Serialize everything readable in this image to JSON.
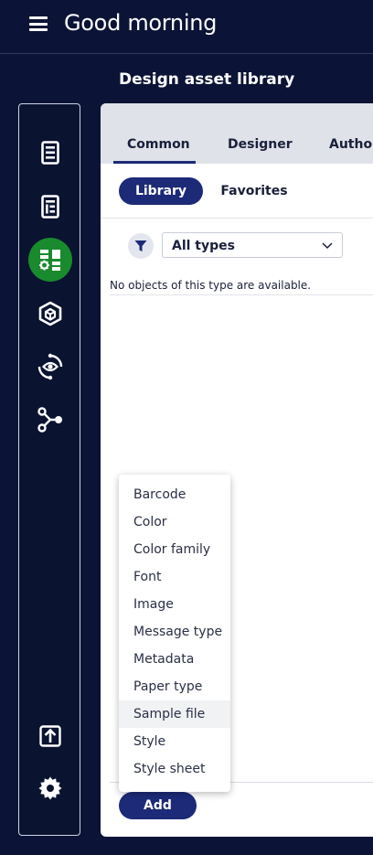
{
  "header": {
    "greeting": "Good morning"
  },
  "section": {
    "title": "Design asset library"
  },
  "sidebar": {
    "items": [
      {
        "icon": "document-list-icon",
        "active": false
      },
      {
        "icon": "template-icon",
        "active": false
      },
      {
        "icon": "design-assets-icon",
        "active": true
      },
      {
        "icon": "package-cube-icon",
        "active": false
      },
      {
        "icon": "preview-eye-icon",
        "active": false
      },
      {
        "icon": "workflow-icon",
        "active": false
      }
    ],
    "bottom_items": [
      {
        "icon": "upload-icon"
      },
      {
        "icon": "settings-gear-icon"
      }
    ],
    "active_color": "#1a8a2e"
  },
  "panel": {
    "tabs": [
      {
        "label": "Common",
        "active": true
      },
      {
        "label": "Designer",
        "active": false
      },
      {
        "label": "Author",
        "active": false
      }
    ],
    "toggles": {
      "library": "Library",
      "favorites": "Favorites",
      "selected": "Library"
    },
    "filter": {
      "icon": "filter-funnel-icon",
      "selected_type": "All types"
    },
    "empty_message": "No objects of this type are available.",
    "add_button": "Add",
    "add_menu": {
      "items": [
        "Barcode",
        "Color",
        "Color family",
        "Font",
        "Image",
        "Message type",
        "Metadata",
        "Paper type",
        "Sample file",
        "Style",
        "Style sheet"
      ],
      "hovered": "Sample file"
    }
  },
  "colors": {
    "background": "#0b1436",
    "accent": "#1d2a78",
    "tab_bar": "#dfe2e8"
  }
}
